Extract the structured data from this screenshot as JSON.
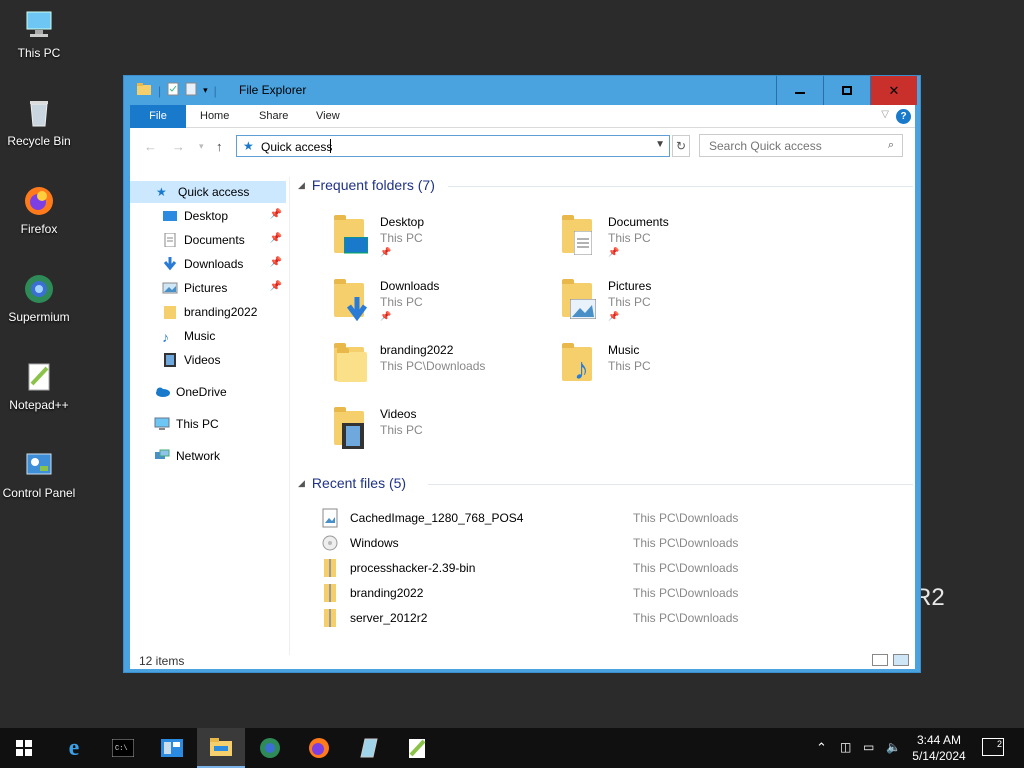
{
  "desktop": {
    "icons": [
      {
        "label": "This PC",
        "icon": "computer-icon"
      },
      {
        "label": "Recycle Bin",
        "icon": "recycle-bin-icon"
      },
      {
        "label": "Firefox",
        "icon": "firefox-icon"
      },
      {
        "label": "Supermium",
        "icon": "supermium-icon"
      },
      {
        "label": "Notepad++",
        "icon": "notepadpp-icon"
      },
      {
        "label": "Control Panel",
        "icon": "control-panel-icon"
      }
    ],
    "watermark_text": "R2"
  },
  "window": {
    "title": "File Explorer",
    "accent": "#4aa3df",
    "controls": {
      "minimize": "—",
      "maximize": "☐",
      "close": "✕"
    }
  },
  "ribbon": {
    "tabs": [
      "File",
      "Home",
      "Share",
      "View"
    ],
    "help": "?"
  },
  "address": {
    "value": "Quick access",
    "search_placeholder": "Search Quick access"
  },
  "nav_pane": {
    "quick_access": "Quick access",
    "pinned": [
      {
        "label": "Desktop",
        "pinned": true
      },
      {
        "label": "Documents",
        "pinned": true
      },
      {
        "label": "Downloads",
        "pinned": true
      },
      {
        "label": "Pictures",
        "pinned": true
      },
      {
        "label": "branding2022",
        "pinned": false
      },
      {
        "label": "Music",
        "pinned": false
      },
      {
        "label": "Videos",
        "pinned": false
      }
    ],
    "onedrive": "OneDrive",
    "this_pc": "This PC",
    "network": "Network"
  },
  "frequent": {
    "header": "Frequent folders (7)",
    "folders": [
      {
        "name": "Desktop",
        "location": "This PC",
        "pinned": true
      },
      {
        "name": "Documents",
        "location": "This PC",
        "pinned": true
      },
      {
        "name": "Downloads",
        "location": "This PC",
        "pinned": true
      },
      {
        "name": "Pictures",
        "location": "This PC",
        "pinned": true
      },
      {
        "name": "branding2022",
        "location": "This PC\\Downloads",
        "pinned": false
      },
      {
        "name": "Music",
        "location": "This PC",
        "pinned": false
      },
      {
        "name": "Videos",
        "location": "This PC",
        "pinned": false
      }
    ]
  },
  "recent": {
    "header": "Recent files (5)",
    "files": [
      {
        "name": "CachedImage_1280_768_POS4",
        "location": "This PC\\Downloads",
        "icon": "image-file-icon"
      },
      {
        "name": "Windows",
        "location": "This PC\\Downloads",
        "icon": "disc-image-icon"
      },
      {
        "name": "processhacker-2.39-bin",
        "location": "This PC\\Downloads",
        "icon": "zip-file-icon"
      },
      {
        "name": "branding2022",
        "location": "This PC\\Downloads",
        "icon": "zip-file-icon"
      },
      {
        "name": "server_2012r2",
        "location": "This PC\\Downloads",
        "icon": "zip-file-icon"
      }
    ]
  },
  "status": {
    "item_count": "12 items"
  },
  "taskbar": {
    "time": "3:44 AM",
    "date": "5/14/2024",
    "notification_count": "2",
    "apps": [
      "start-icon",
      "internet-explorer-icon",
      "cmd-icon",
      "server-manager-icon",
      "file-explorer-icon",
      "supermium-icon",
      "firefox-icon",
      "notepadpp-icon",
      "pad-icon"
    ]
  }
}
